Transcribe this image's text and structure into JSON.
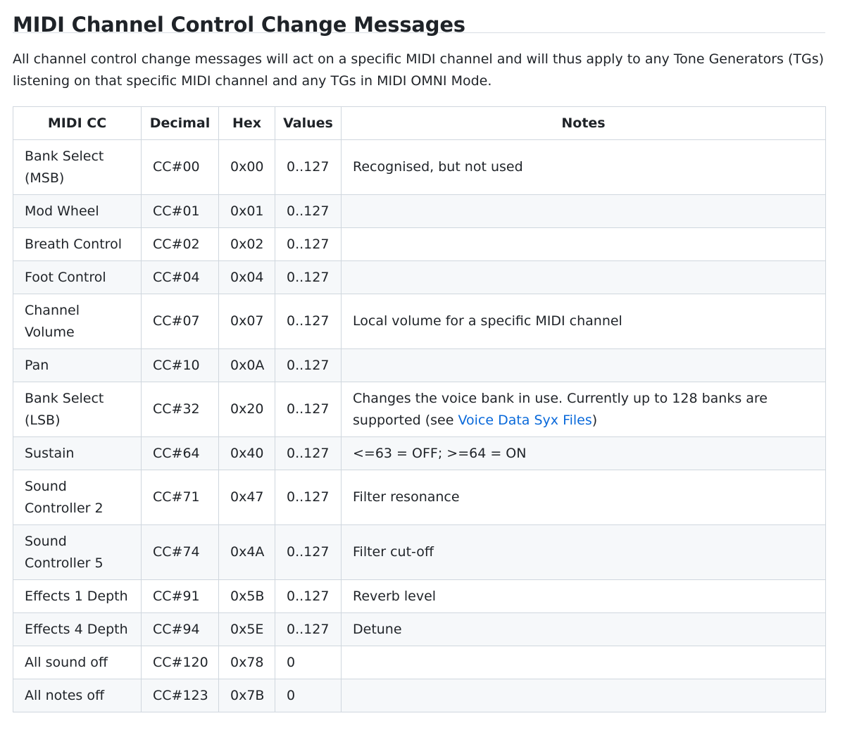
{
  "heading": "MIDI Channel Control Change Messages",
  "intro": "All channel control change messages will act on a specific MIDI channel and will thus apply to any Tone Generators (TGs) listening on that specific MIDI channel and any TGs in MIDI OMNI Mode.",
  "table": {
    "headers": {
      "cc": "MIDI CC",
      "decimal": "Decimal",
      "hex": "Hex",
      "values": "Values",
      "notes": "Notes"
    },
    "rows": [
      {
        "name": "Bank Select (MSB)",
        "decimal": "CC#00",
        "hex": "0x00",
        "values": "0..127",
        "notes": "Recognised, but not used"
      },
      {
        "name": "Mod Wheel",
        "decimal": "CC#01",
        "hex": "0x01",
        "values": "0..127",
        "notes": ""
      },
      {
        "name": "Breath Control",
        "decimal": "CC#02",
        "hex": "0x02",
        "values": "0..127",
        "notes": ""
      },
      {
        "name": "Foot Control",
        "decimal": "CC#04",
        "hex": "0x04",
        "values": "0..127",
        "notes": ""
      },
      {
        "name": "Channel Volume",
        "decimal": "CC#07",
        "hex": "0x07",
        "values": "0..127",
        "notes": "Local volume for a specific MIDI channel"
      },
      {
        "name": "Pan",
        "decimal": "CC#10",
        "hex": "0x0A",
        "values": "0..127",
        "notes": ""
      },
      {
        "name": "Bank Select (LSB)",
        "decimal": "CC#32",
        "hex": "0x20",
        "values": "0..127",
        "notes": "Changes the voice bank in use. Currently up to 128 banks are supported (see ",
        "link": "Voice Data Syx Files",
        "notes_after": ")"
      },
      {
        "name": "Sustain",
        "decimal": "CC#64",
        "hex": "0x40",
        "values": "0..127",
        "notes": "<=63 = OFF; >=64 = ON"
      },
      {
        "name": "Sound Controller 2",
        "decimal": "CC#71",
        "hex": "0x47",
        "values": "0..127",
        "notes": "Filter resonance"
      },
      {
        "name": "Sound Controller 5",
        "decimal": "CC#74",
        "hex": "0x4A",
        "values": "0..127",
        "notes": "Filter cut-off"
      },
      {
        "name": "Effects 1 Depth",
        "decimal": "CC#91",
        "hex": "0x5B",
        "values": "0..127",
        "notes": "Reverb level"
      },
      {
        "name": "Effects 4 Depth",
        "decimal": "CC#94",
        "hex": "0x5E",
        "values": "0..127",
        "notes": "Detune"
      },
      {
        "name": "All sound off",
        "decimal": "CC#120",
        "hex": "0x78",
        "values": "0",
        "notes": ""
      },
      {
        "name": "All notes off",
        "decimal": "CC#123",
        "hex": "0x7B",
        "values": "0",
        "notes": ""
      }
    ]
  }
}
